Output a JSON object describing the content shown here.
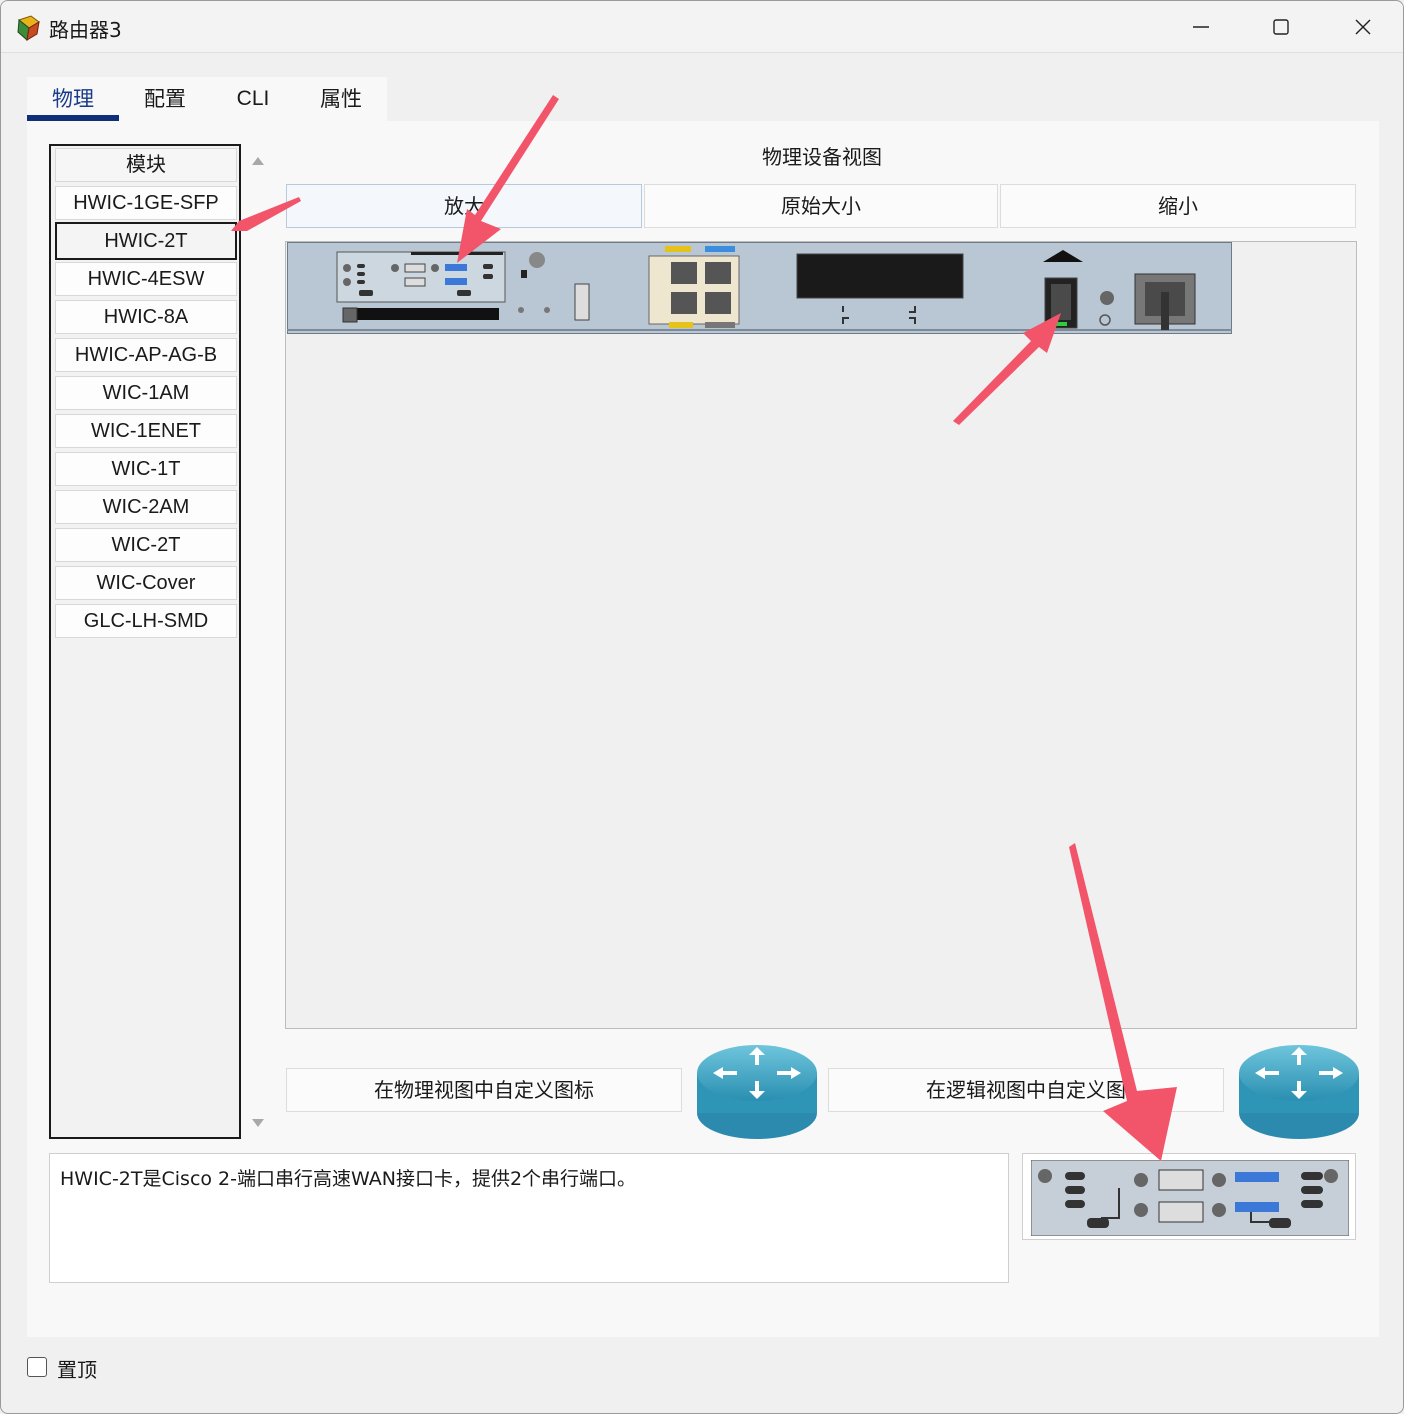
{
  "window": {
    "title": "路由器3",
    "controls": [
      "minimize",
      "maximize",
      "close"
    ]
  },
  "tabs": [
    {
      "label": "物理",
      "active": true
    },
    {
      "label": "配置",
      "active": false
    },
    {
      "label": "CLI",
      "active": false
    },
    {
      "label": "属性",
      "active": false
    }
  ],
  "modules": {
    "header": "模块",
    "items": [
      "HWIC-1GE-SFP",
      "HWIC-2T",
      "HWIC-4ESW",
      "HWIC-8A",
      "HWIC-AP-AG-B",
      "WIC-1AM",
      "WIC-1ENET",
      "WIC-1T",
      "WIC-2AM",
      "WIC-2T",
      "WIC-Cover",
      "GLC-LH-SMD"
    ],
    "selected": "HWIC-2T"
  },
  "physical_view": {
    "title": "物理设备视图",
    "zoom_in": "放大",
    "original_size": "原始大小",
    "zoom_out": "缩小"
  },
  "custom_icons": {
    "physical": "在物理视图中自定义图标",
    "logical": "在逻辑视图中自定义图"
  },
  "description": "HWIC-2T是Cisco 2-端口串行高速WAN接口卡，提供2个串行端口。",
  "pin_label": "置顶",
  "colors": {
    "tab_accent": "#0f2f78",
    "annotation_arrow": "#f2556a",
    "router_icon": "#3aa9c9",
    "chassis": "#b9c6d3"
  }
}
